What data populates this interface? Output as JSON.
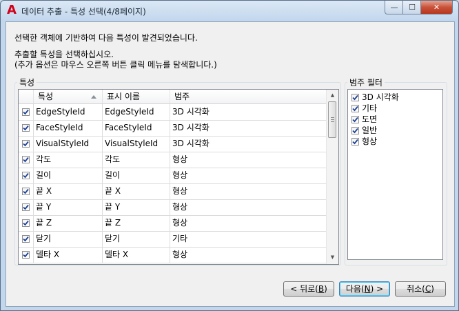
{
  "window": {
    "title": "데이터 추출 - 특성 선택(4/8페이지)",
    "app_icon_glyph": "A",
    "accent": "#d2001a"
  },
  "titlebar_buttons": {
    "minimize": "—",
    "maximize": "☐",
    "close": "✕"
  },
  "description": {
    "line1": "선택한 객체에 기반하여 다음 특성이 발견되었습니다.",
    "line2": "추출할 특성을 선택하십시오.",
    "line3": "(추가 옵션은 마우스 오른쪽 버튼 클릭 메뉴를 탐색합니다.)"
  },
  "properties": {
    "group_label": "특성",
    "columns": {
      "property": "특성",
      "display_name": "표시 이름",
      "category": "범주"
    },
    "sort": {
      "column": "property",
      "direction": "ascending"
    },
    "rows": [
      {
        "checked": true,
        "property": "EdgeStyleId",
        "display_name": "EdgeStyleId",
        "category": "3D 시각화"
      },
      {
        "checked": true,
        "property": "FaceStyleId",
        "display_name": "FaceStyleId",
        "category": "3D 시각화"
      },
      {
        "checked": true,
        "property": "VisualStyleId",
        "display_name": "VisualStyleId",
        "category": "3D 시각화"
      },
      {
        "checked": true,
        "property": "각도",
        "display_name": "각도",
        "category": "형상"
      },
      {
        "checked": true,
        "property": "길이",
        "display_name": "길이",
        "category": "형상"
      },
      {
        "checked": true,
        "property": "끝 X",
        "display_name": "끝 X",
        "category": "형상"
      },
      {
        "checked": true,
        "property": "끝 Y",
        "display_name": "끝 Y",
        "category": "형상"
      },
      {
        "checked": true,
        "property": "끝 Z",
        "display_name": "끝 Z",
        "category": "형상"
      },
      {
        "checked": true,
        "property": "닫기",
        "display_name": "닫기",
        "category": "기타"
      },
      {
        "checked": true,
        "property": "델타 X",
        "display_name": "델타 X",
        "category": "형상"
      }
    ]
  },
  "category_filter": {
    "group_label": "범주 필터",
    "items": [
      {
        "checked": true,
        "label": "3D 시각화"
      },
      {
        "checked": true,
        "label": "기타"
      },
      {
        "checked": true,
        "label": "도면"
      },
      {
        "checked": true,
        "label": "일반"
      },
      {
        "checked": true,
        "label": "형상"
      }
    ]
  },
  "buttons": {
    "back": {
      "label": "< 뒤로(",
      "mnemonic": "B",
      "suffix": ")"
    },
    "next": {
      "label": "다음(",
      "mnemonic": "N",
      "suffix": ") >"
    },
    "cancel": {
      "label": "취소(",
      "mnemonic": "C",
      "suffix": ")"
    }
  }
}
